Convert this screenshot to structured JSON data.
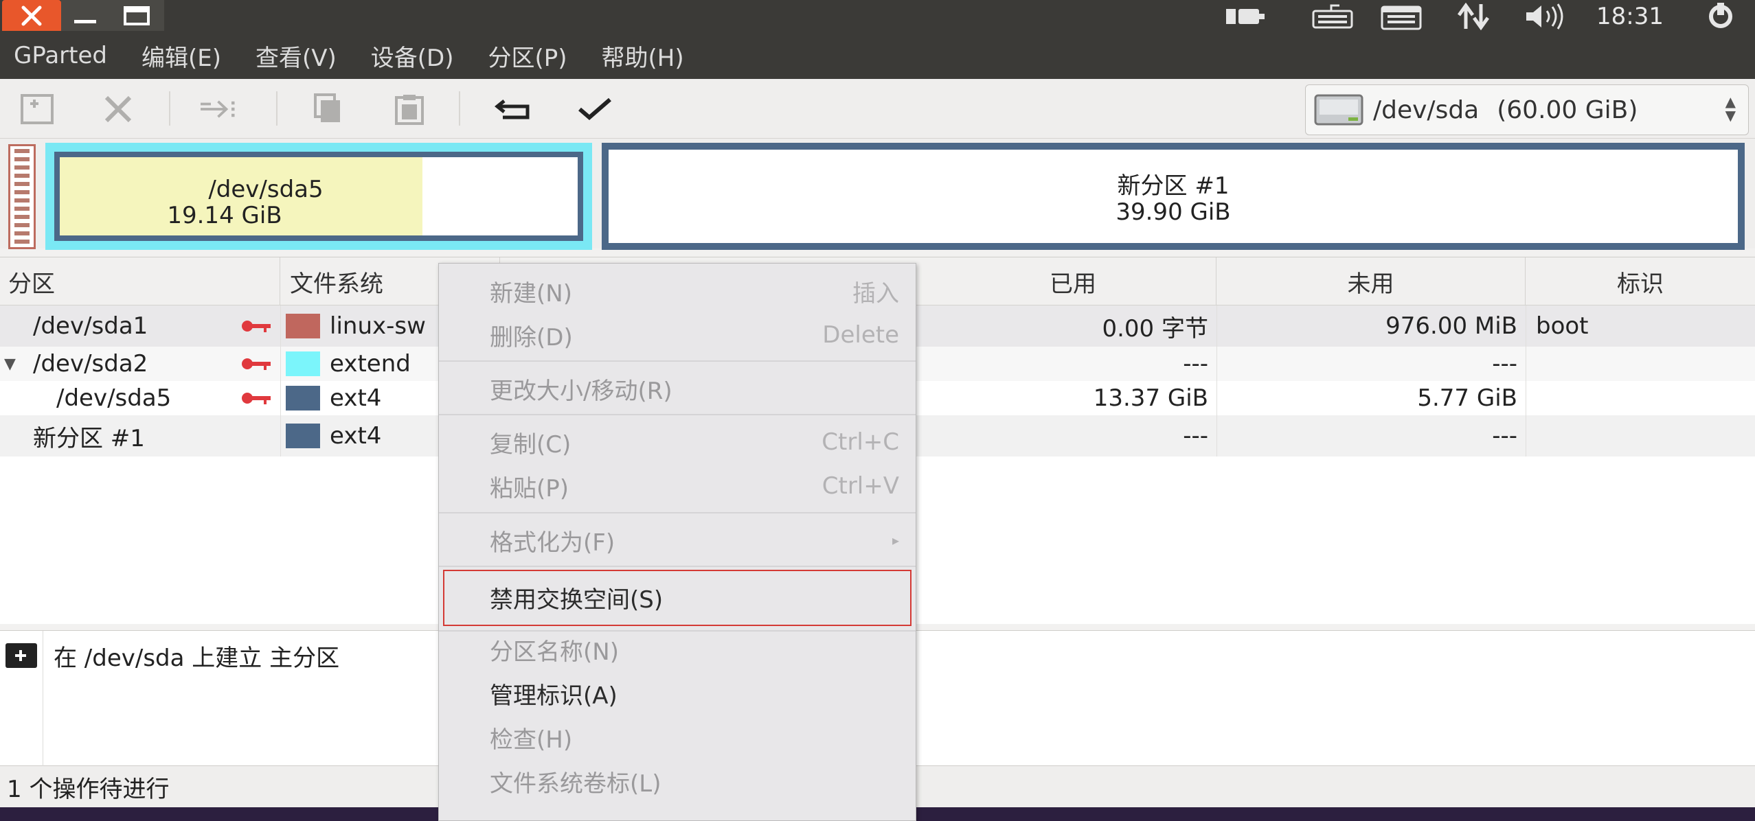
{
  "topbar": {
    "clock": "18:31",
    "icons": [
      "battery-icon",
      "keyboard-icon",
      "input-method-icon",
      "network-icon",
      "volume-icon",
      "power-icon"
    ]
  },
  "menubar": {
    "items": [
      "GParted",
      "编辑(E)",
      "查看(V)",
      "设备(D)",
      "分区(P)",
      "帮助(H)"
    ]
  },
  "toolbar": {
    "device": "/dev/sda",
    "device_size": "(60.00 GiB)"
  },
  "partition_bar": {
    "sda5": {
      "name": "/dev/sda5",
      "size": "19.14 GiB",
      "used_fraction": 0.7
    },
    "new1": {
      "name": "新分区 #1",
      "size": "39.90 GiB"
    }
  },
  "table": {
    "headers": [
      "分区",
      "文件系统",
      "已用",
      "未用",
      "标识"
    ],
    "rows": [
      {
        "partition": "/dev/sda1",
        "fs": "linux-sw",
        "used": "0.00 字节",
        "unused": "976.00 MiB",
        "flags": "boot",
        "color": "#c0675e",
        "locked": true
      },
      {
        "partition": "/dev/sda2",
        "fs": "extend",
        "used": "---",
        "unused": "---",
        "flags": "",
        "color": "#7bf5fb",
        "locked": true
      },
      {
        "partition": "/dev/sda5",
        "fs": "ext4",
        "used": "13.37 GiB",
        "unused": "5.77 GiB",
        "flags": "",
        "color": "#4c6888",
        "locked": true
      },
      {
        "partition": "新分区 #1",
        "fs": "ext4",
        "used": "---",
        "unused": "---",
        "flags": "",
        "color": "#4c6888",
        "locked": false
      }
    ]
  },
  "operations": {
    "items": [
      "在 /dev/sda 上建立 主分区"
    ]
  },
  "status": {
    "text": "1 个操作待进行"
  },
  "context_menu": {
    "items": [
      {
        "label": "新建(N)",
        "accel": "插入",
        "enabled": false
      },
      {
        "label": "删除(D)",
        "accel": "Delete",
        "enabled": false
      },
      {
        "label": "更改大小/移动(R)",
        "accel": "",
        "enabled": false
      },
      {
        "label": "复制(C)",
        "accel": "Ctrl+C",
        "enabled": false
      },
      {
        "label": "粘贴(P)",
        "accel": "Ctrl+V",
        "enabled": false
      },
      {
        "label": "格式化为(F)",
        "accel": "",
        "enabled": false
      },
      {
        "label": "禁用交换空间(S)",
        "accel": "",
        "enabled": true
      },
      {
        "label": "分区名称(N)",
        "accel": "",
        "enabled": false
      },
      {
        "label": "管理标识(A)",
        "accel": "",
        "enabled": true
      },
      {
        "label": "检查(H)",
        "accel": "",
        "enabled": false
      },
      {
        "label": "文件系统卷标(L)",
        "accel": "",
        "enabled": false
      }
    ]
  },
  "colors": {
    "accent_close": "#e8572b",
    "highlight": "#d43a35",
    "selection_cyan": "#7ae8f4"
  }
}
